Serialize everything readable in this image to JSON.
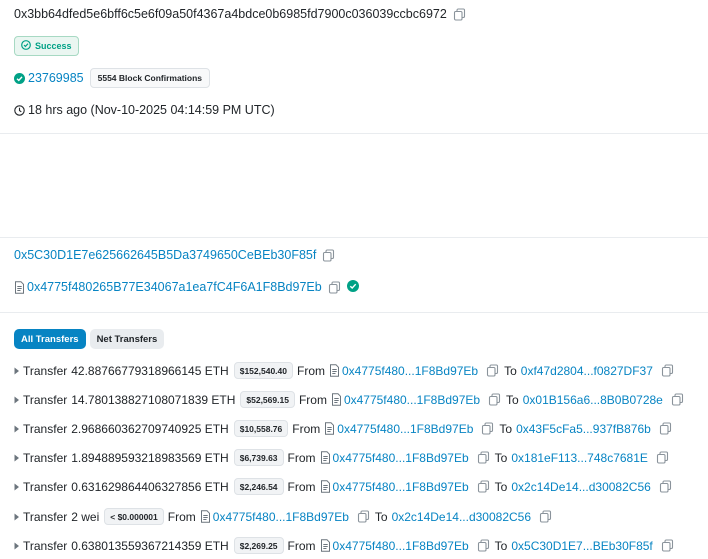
{
  "tx_hash": "0x3bb64dfed5e6bff6c5e6f09a50f4367a4bdce0b6985fd7900c036039ccbc6972",
  "status": "Success",
  "block": {
    "number": "23769985",
    "confirmations": "5554 Block Confirmations"
  },
  "timestamp": "18 hrs ago (Nov-10-2025 04:14:59 PM UTC)",
  "from_address": "0x5C30D1E7e625662645B5Da3749650CeBEb30F85f",
  "interacted_with": "0x4775f480265B77E34067a1ea7fC4F6A1F8Bd97Eb",
  "tabs": {
    "all": "All Transfers",
    "net": "Net Transfers"
  },
  "transfer_word": "Transfer",
  "from_word": "From",
  "to_word": "To",
  "transfers": [
    {
      "amount": "42.88766779318966145 ETH",
      "usd": "$152,540.40",
      "from": "0x4775f480...1F8Bd97Eb",
      "to": "0xf47d2804...f0827DF37"
    },
    {
      "amount": "14.780138827108071839 ETH",
      "usd": "$52,569.15",
      "from": "0x4775f480...1F8Bd97Eb",
      "to": "0x01B156a6...8B0B0728e"
    },
    {
      "amount": "2.968660362709740925 ETH",
      "usd": "$10,558.76",
      "from": "0x4775f480...1F8Bd97Eb",
      "to": "0x43F5cFa5...937fB876b"
    },
    {
      "amount": "1.894889593218983569 ETH",
      "usd": "$6,739.63",
      "from": "0x4775f480...1F8Bd97Eb",
      "to": "0x181eF113...748c7681E"
    },
    {
      "amount": "0.631629864406327856 ETH",
      "usd": "$2,246.54",
      "from": "0x4775f480...1F8Bd97Eb",
      "to": "0x2c14De14...d30082C56"
    },
    {
      "amount": "2 wei",
      "usd": "< $0.000001",
      "from": "0x4775f480...1F8Bd97Eb",
      "to": "0x2c14De14...d30082C56"
    },
    {
      "amount": "0.638013559367214359 ETH",
      "usd": "$2,269.25",
      "from": "0x4775f480...1F8Bd97Eb",
      "to": "0x5C30D1E7...BEb30F85f"
    }
  ],
  "colors": {
    "link": "#0784c3",
    "success": "#00a186",
    "active_tab": "#0784c3"
  }
}
